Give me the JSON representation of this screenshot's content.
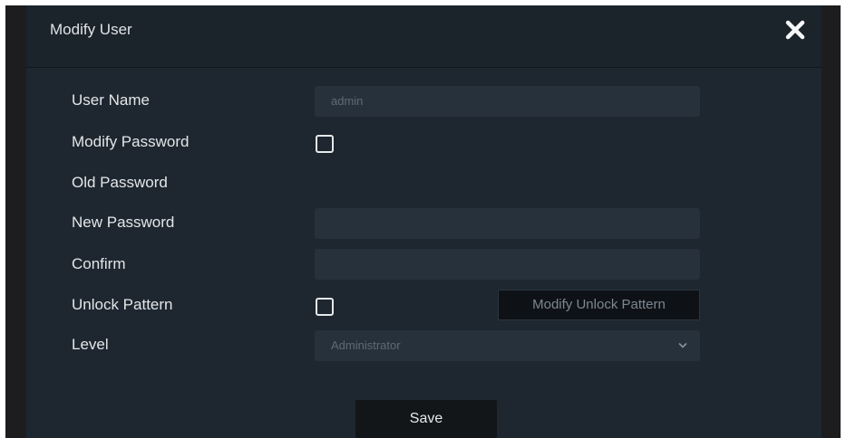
{
  "dialog": {
    "title": "Modify User",
    "close_icon": "close-icon"
  },
  "form": {
    "user_name": {
      "label": "User Name",
      "value": "admin"
    },
    "modify_password": {
      "label": "Modify Password",
      "checked": false
    },
    "old_password": {
      "label": "Old Password"
    },
    "new_password": {
      "label": "New Password",
      "value": ""
    },
    "confirm": {
      "label": "Confirm",
      "value": ""
    },
    "unlock_pattern": {
      "label": "Unlock Pattern",
      "checked": false,
      "button_label": "Modify Unlock Pattern"
    },
    "level": {
      "label": "Level",
      "selected": "Administrator",
      "icon": "chevron-down-icon"
    }
  },
  "actions": {
    "save_label": "Save"
  },
  "colors": {
    "dialog_bg": "#1e2730",
    "field_bg": "#27313b",
    "text": "#e3e6e8",
    "muted_text": "#5f6a74"
  }
}
